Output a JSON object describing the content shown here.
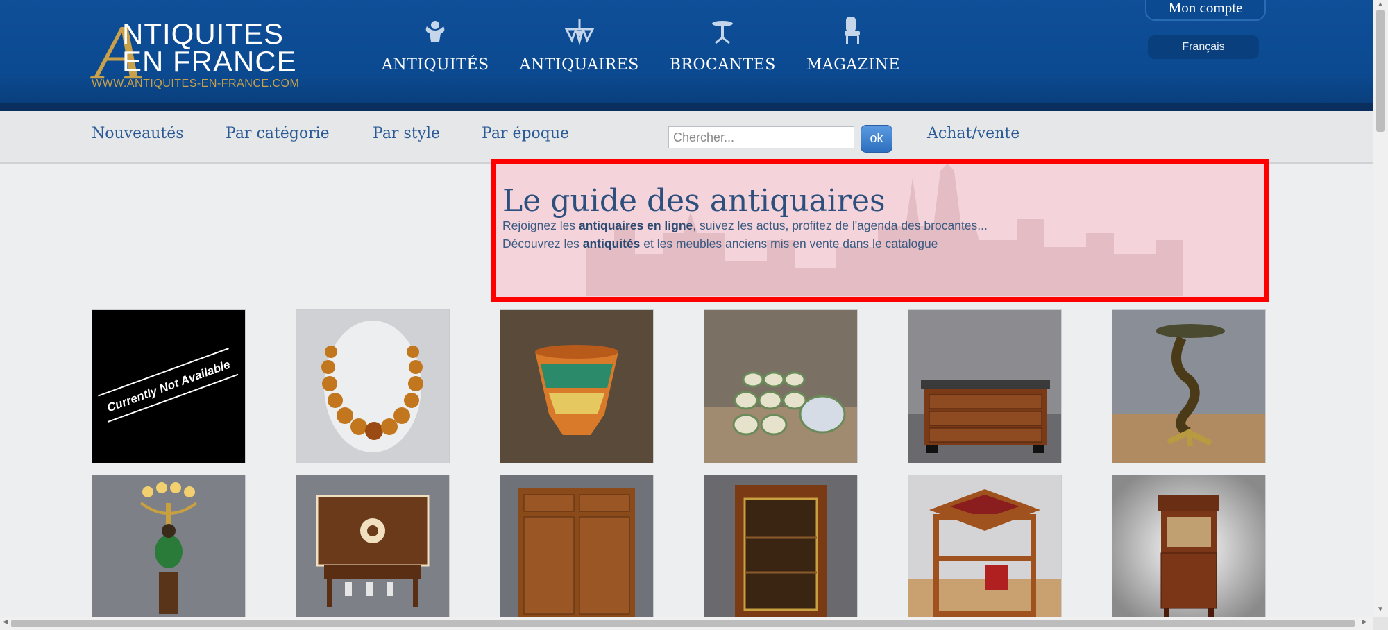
{
  "logo": {
    "line1": "NTIQUITES",
    "line2": "EN FRANCE",
    "letter": "A",
    "url": "WWW.ANTIQUITES-EN-FRANCE.COM"
  },
  "main_nav": [
    {
      "label": "ANTIQUITÉS",
      "icon": "cherub-icon"
    },
    {
      "label": "ANTIQUAIRES",
      "icon": "chandelier-icon"
    },
    {
      "label": "BROCANTES",
      "icon": "table-icon"
    },
    {
      "label": "MAGAZINE",
      "icon": "chair-icon"
    }
  ],
  "account": {
    "label": "Mon compte"
  },
  "language": {
    "label": "Français"
  },
  "sub_nav": {
    "items": [
      "Nouveautés",
      "Par catégorie",
      "Par style",
      "Par époque"
    ],
    "achat": "Achat/vente",
    "search_placeholder": "Chercher...",
    "ok_label": "ok"
  },
  "hero": {
    "title": "Le guide des antiquaires",
    "line1_pre": "Rejoignez les ",
    "line1_bold": "antiquaires en ligne",
    "line1_post": ", suivez les actus, profitez de l'agenda des brocantes...",
    "line2_pre": "Découvrez les ",
    "line2_bold": "antiquités",
    "line2_post": " et les meubles anciens mis en vente dans le catalogue"
  },
  "products": [
    {
      "name": "not-available",
      "caption": "Currently Not Available"
    },
    {
      "name": "amber-necklace"
    },
    {
      "name": "ceramic-vase"
    },
    {
      "name": "ceramic-cups-set"
    },
    {
      "name": "chest-of-drawers"
    },
    {
      "name": "gilded-pedestal-table"
    },
    {
      "name": "candelabra-statue"
    },
    {
      "name": "inlaid-cabinet"
    },
    {
      "name": "wooden-buffet"
    },
    {
      "name": "glass-vitrine"
    },
    {
      "name": "revolving-bookcase"
    },
    {
      "name": "secretaire-desk"
    }
  ],
  "colors": {
    "header_blue": "#0b4a91",
    "gold": "#c9a14a",
    "link_blue": "#2a5a95",
    "highlight_border": "#ff0000"
  }
}
